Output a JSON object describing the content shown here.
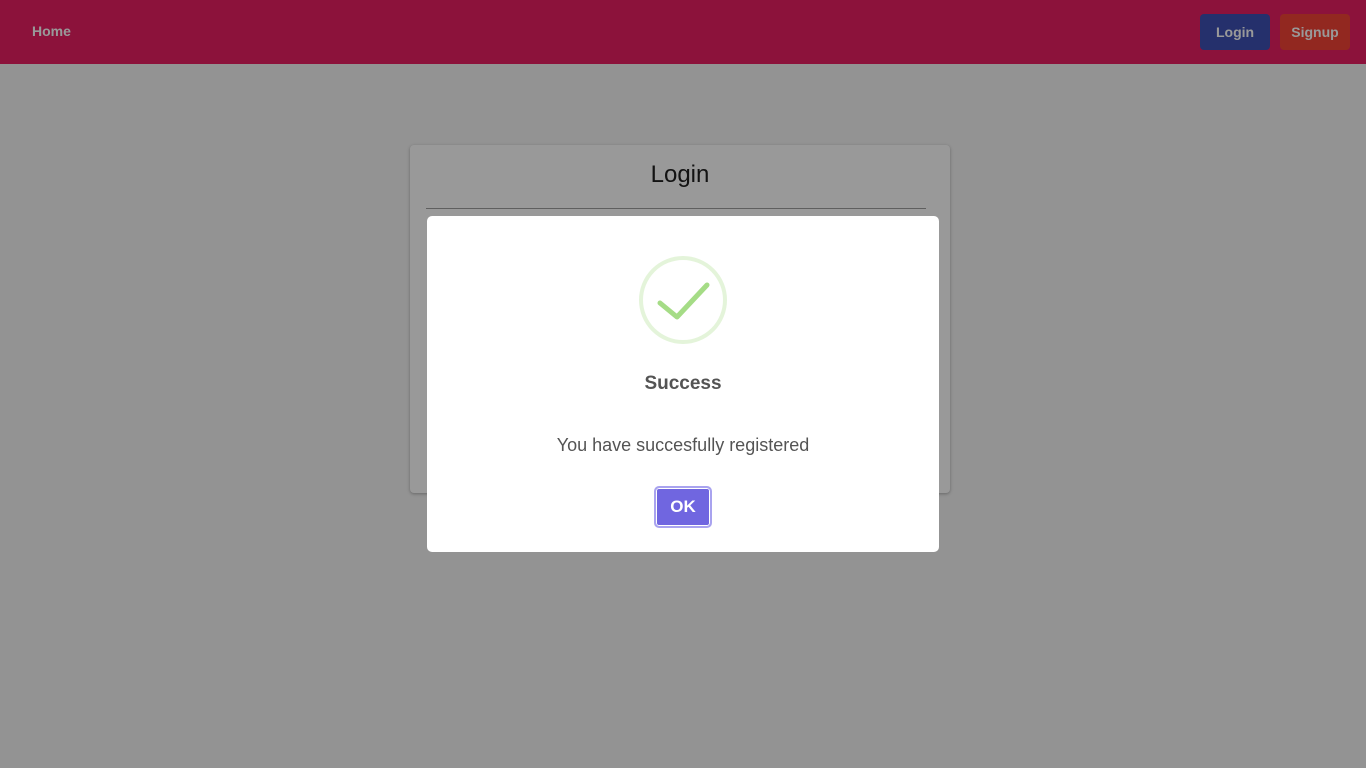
{
  "navbar": {
    "home_label": "Home",
    "login_label": "Login",
    "signup_label": "Signup"
  },
  "login_card": {
    "title": "Login"
  },
  "modal": {
    "icon": "check-circle-icon",
    "title": "Success",
    "text": "You have succesfully registered",
    "ok_label": "OK"
  },
  "colors": {
    "navbar": "#e91e63",
    "login_button": "#3f51b5",
    "signup_button": "#f44336",
    "ok_button": "#7066e0",
    "success": "#a5dc86"
  }
}
